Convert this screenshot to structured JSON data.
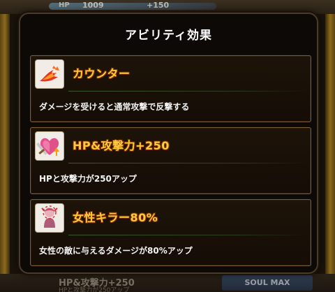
{
  "background": {
    "hp_label": "HP",
    "hp_value": "1009",
    "hp_bonus": "+150",
    "bottom_ghost_title": "HP&攻撃力+250",
    "bottom_ghost_sub": "HPと攻撃力が250アップ",
    "soul_button_label": "SOUL MAX"
  },
  "popup": {
    "title": "アビリティ効果",
    "abilities": [
      {
        "name": "カウンター",
        "description": "ダメージを受けると通常攻撃で反撃する",
        "icon": "flame-claw-icon"
      },
      {
        "name": "HP&攻撃力+250",
        "description": "HPと攻撃力が250アップ",
        "icon": "heart-sword-icon"
      },
      {
        "name": "女性キラー80%",
        "description": "女性の敵に与えるダメージが80%アップ",
        "icon": "female-killer-icon"
      }
    ]
  },
  "colors": {
    "ability_name": "#ffcc36",
    "card_border": "#7a5a33",
    "popup_bg": "#0c0906"
  }
}
